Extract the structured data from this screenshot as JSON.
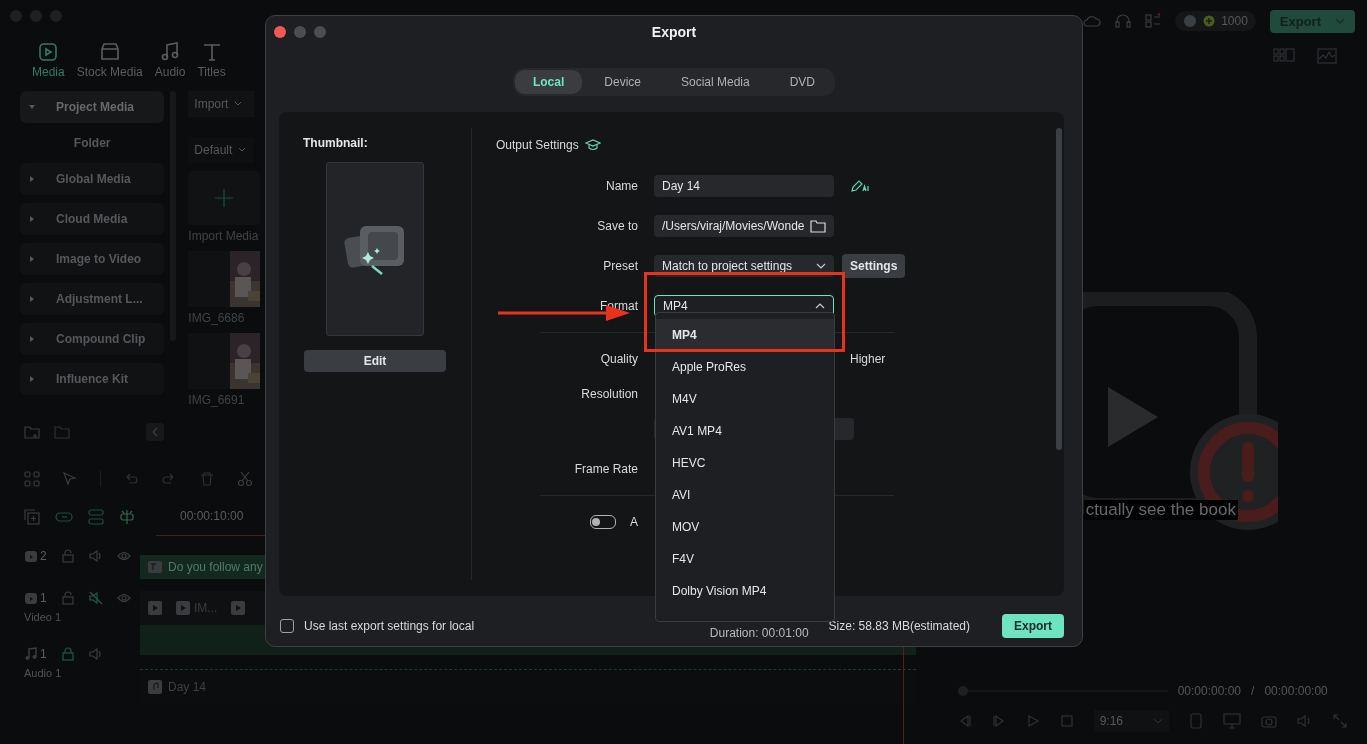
{
  "app": {
    "media_tabs": [
      {
        "label": "Media",
        "kind": "media",
        "selected": true
      },
      {
        "label": "Stock Media",
        "kind": "stock",
        "selected": false
      },
      {
        "label": "Audio",
        "kind": "audio",
        "selected": false
      },
      {
        "label": "Titles",
        "kind": "titles",
        "selected": false
      }
    ],
    "media_sidebar": [
      {
        "label": "Project Media",
        "expanded": true,
        "selected": true,
        "children": [
          {
            "label": "Folder"
          }
        ]
      },
      {
        "label": "Global Media",
        "expanded": false,
        "selected": false
      },
      {
        "label": "Cloud Media",
        "expanded": false,
        "selected": false
      },
      {
        "label": "Image to Video",
        "expanded": false,
        "selected": false
      },
      {
        "label": "Adjustment L...",
        "expanded": false,
        "selected": false
      },
      {
        "label": "Compound Clip",
        "expanded": false,
        "selected": false
      },
      {
        "label": "Influence Kit",
        "expanded": false,
        "selected": false
      }
    ],
    "import_button": "Import",
    "sort_button": "Default",
    "media_items": [
      {
        "label": "Import Media",
        "kind": "add"
      },
      {
        "label": "IMG_6686",
        "kind": "picture"
      },
      {
        "label": "IMG_6691",
        "kind": "picture"
      }
    ],
    "credits": "1000",
    "export_button": "Export",
    "timeline": {
      "ruler_time": "00:00:10:00",
      "tracks": [
        {
          "kind": "video",
          "number": "2",
          "muted": false,
          "locked": false,
          "clip": {
            "kind": "title",
            "text": "Do you follow any"
          }
        },
        {
          "kind": "video",
          "number": "1",
          "label": "Video 1",
          "muted": true,
          "locked": false,
          "clip": {
            "kind": "video",
            "text": "IM..."
          }
        },
        {
          "kind": "audio",
          "number": "1",
          "label": "Audio 1",
          "muted": false,
          "locked": true,
          "clip": {
            "kind": "audio",
            "text": "Day 14"
          }
        }
      ]
    },
    "preview": {
      "caption": "ctually see the book",
      "current_time": "00:00:00:00",
      "separator": "/",
      "total_time": "00:00:00:00",
      "aspect": "9:16"
    }
  },
  "dialog": {
    "title": "Export",
    "tabs": [
      {
        "label": "Local",
        "selected": true
      },
      {
        "label": "Device",
        "selected": false
      },
      {
        "label": "Social Media",
        "selected": false
      },
      {
        "label": "DVD",
        "selected": false
      }
    ],
    "thumbnail_label": "Thumbnail:",
    "edit_button": "Edit",
    "output_settings": "Output Settings",
    "fields": [
      {
        "label": "Name",
        "kind": "text",
        "value": "Day 14"
      },
      {
        "label": "Save to",
        "kind": "path",
        "value": "/Users/viraj/Movies/Wonde"
      },
      {
        "label": "Preset",
        "kind": "select",
        "value": "Match to project settings",
        "button": "Settings"
      },
      {
        "label": "Format",
        "kind": "open-select",
        "value": "MP4"
      }
    ],
    "quality": {
      "label": "Quality",
      "end_label": "Higher"
    },
    "resolution_label": "Resolution",
    "frame_rate_label": "Frame Rate",
    "toggle": {
      "on": false,
      "label": "A"
    },
    "format_options": [
      {
        "label": "MP4",
        "selected": true
      },
      {
        "label": "Apple ProRes",
        "selected": false
      },
      {
        "label": "M4V",
        "selected": false
      },
      {
        "label": "AV1 MP4",
        "selected": false
      },
      {
        "label": "HEVC",
        "selected": false
      },
      {
        "label": "AVI",
        "selected": false
      },
      {
        "label": "MOV",
        "selected": false
      },
      {
        "label": "F4V",
        "selected": false
      },
      {
        "label": "Dolby Vision MP4",
        "selected": false
      }
    ],
    "use_last": {
      "label": "Use last export settings for local",
      "checked": false
    },
    "duration": "Duration: 00:01:00",
    "size": "Size: 58.83 MB(estimated)",
    "export_button": "Export"
  }
}
